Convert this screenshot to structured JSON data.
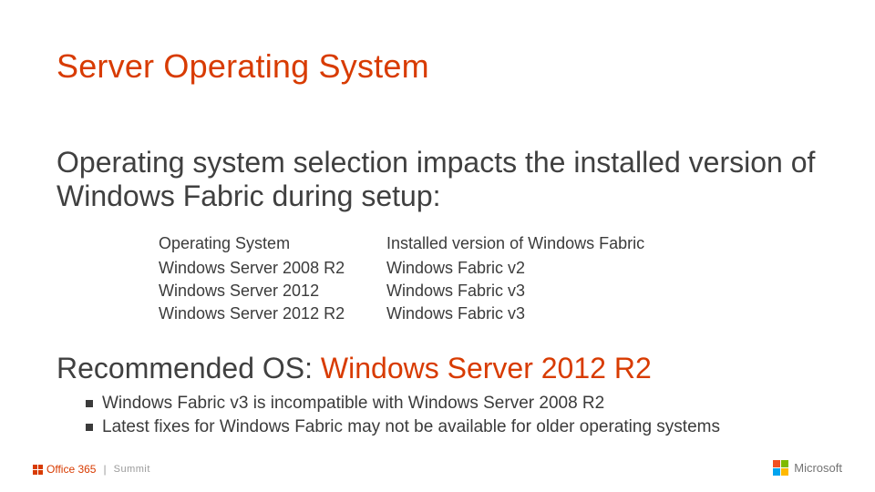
{
  "title": "Server Operating System",
  "intro": "Operating system selection impacts the installed version of Windows Fabric during setup:",
  "table": {
    "headers": {
      "os": "Operating System",
      "ver": "Installed version of Windows Fabric"
    },
    "rows": [
      {
        "os": "Windows Server 2008 R2",
        "ver": "Windows Fabric v2"
      },
      {
        "os": "Windows Server 2012",
        "ver": "Windows Fabric v3"
      },
      {
        "os": "Windows Server 2012 R2",
        "ver": "Windows Fabric v3"
      }
    ]
  },
  "recommended": {
    "label": "Recommended OS:  ",
    "value": "Windows Server 2012 R2"
  },
  "bullets": [
    "Windows Fabric v3 is incompatible with Windows Server 2008 R2",
    "Latest fixes for Windows Fabric may not be available for older operating systems"
  ],
  "footer": {
    "office": "Office 365",
    "summit": "Summit",
    "microsoft": "Microsoft"
  }
}
